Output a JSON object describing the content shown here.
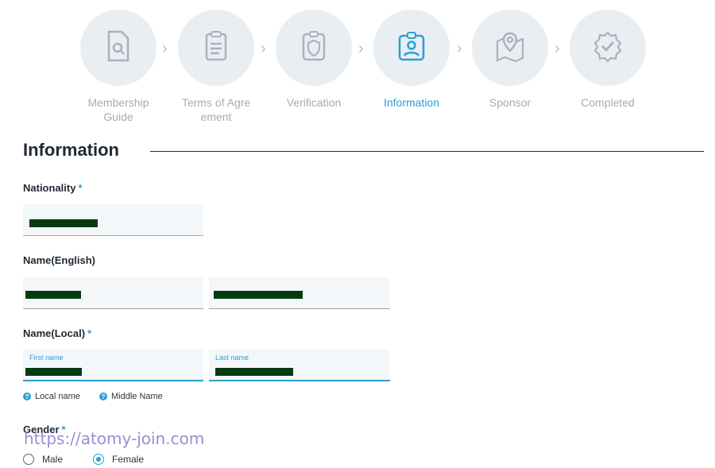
{
  "steps": [
    {
      "label": "Membership Guide",
      "icon": "document-search-icon",
      "active": false
    },
    {
      "label": "Terms of Agre ement",
      "icon": "clipboard-icon",
      "active": false
    },
    {
      "label": "Verification",
      "icon": "shield-clipboard-icon",
      "active": false
    },
    {
      "label": "Information",
      "icon": "id-badge-icon",
      "active": true
    },
    {
      "label": "Sponsor",
      "icon": "map-pin-icon",
      "active": false
    },
    {
      "label": "Completed",
      "icon": "verified-badge-icon",
      "active": false
    }
  ],
  "page_title": "Information",
  "form": {
    "nationality": {
      "label": "Nationality",
      "required": "*"
    },
    "name_english": {
      "label": "Name(English)"
    },
    "name_local": {
      "label": "Name(Local)",
      "required": "*",
      "first_label": "First name",
      "last_label": "Last name"
    },
    "hints": [
      "Local name",
      "Middle Name"
    ],
    "gender": {
      "label": "Gender",
      "required": "*",
      "options": [
        "Male",
        "Female"
      ],
      "selected": "Female"
    }
  },
  "watermark": "https://atomy-join.com",
  "colors": {
    "accent": "#2a9fd6",
    "muted": "#a4acb6",
    "circle": "#e9eef3"
  }
}
